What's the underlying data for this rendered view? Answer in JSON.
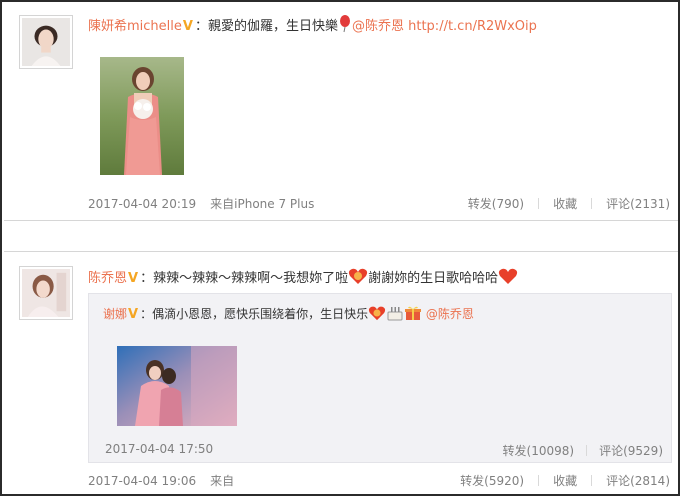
{
  "post1": {
    "username": "陳妍希michelle",
    "text_before_emoji": "：親愛的伽羅，生日快樂",
    "mention": "@陈乔恩",
    "link": "http://t.cn/R2WxOip",
    "time": "2017-04-04 20:19",
    "source": "来自iPhone 7 Plus",
    "repost_label": "转发(790)",
    "favorite_label": "收藏",
    "comment_label": "评论(2131)"
  },
  "post2": {
    "username": "陈乔恩",
    "text_part1": "：辣辣～辣辣～辣辣啊～我想妳了啦",
    "text_part2": "謝謝妳的生日歌哈哈哈",
    "time": "2017-04-04 19:06",
    "source": "来自",
    "repost_label": "转发(5920)",
    "favorite_label": "收藏",
    "comment_label": "评论(2814)",
    "retweet": {
      "username": "谢娜",
      "text": "：偶滴小恩恩，愿快乐围绕着你，生日快乐",
      "mention": "@陈乔恩",
      "time": "2017-04-04 17:50",
      "repost_label": "转发(10098)",
      "comment_label": "评论(9529)"
    }
  },
  "colors": {
    "username": "#eb7350",
    "badge": "#f5a623",
    "meta": "#808080",
    "repost_bg": "#f2f2f5"
  }
}
